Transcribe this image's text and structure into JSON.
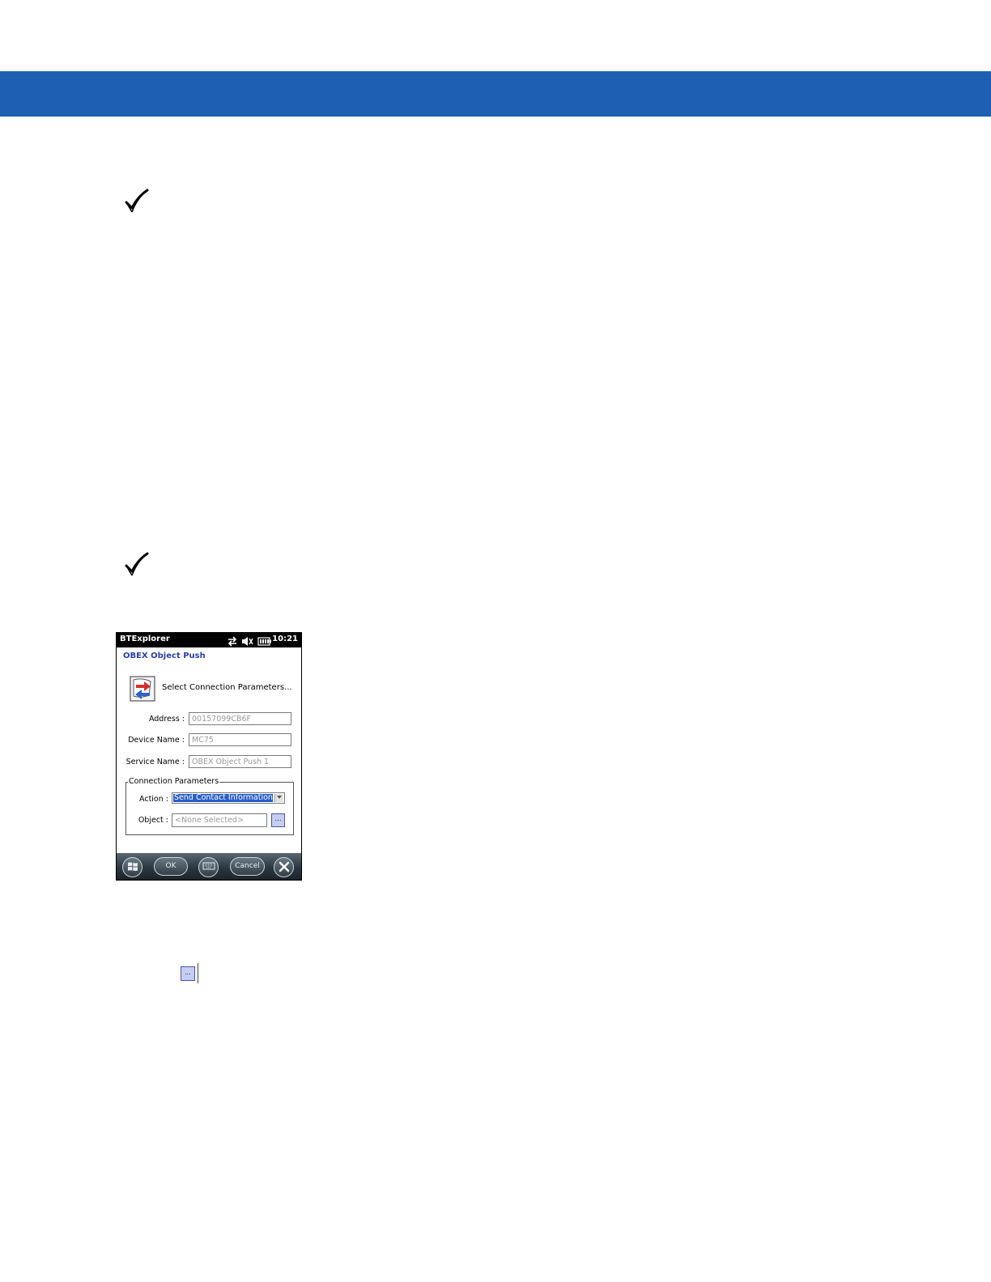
{
  "page": {
    "header_band_color": "#1e5fb4",
    "note_icon": "checkmark-icon"
  },
  "phone": {
    "status_bar": {
      "app_title": "BTExplorer",
      "icons": [
        "connectivity-icon",
        "speaker-muted-icon",
        "battery-icon"
      ],
      "time": "10:21"
    },
    "screen_title": "OBEX Object Push",
    "prompt": "Select Connection Parameters...",
    "fields": [
      {
        "label": "Address :",
        "value": "00157099CB6F"
      },
      {
        "label": "Device Name :",
        "value": "MC75"
      },
      {
        "label": "Service Name :",
        "value": "OBEX Object Push 1"
      }
    ],
    "connection_parameters": {
      "group_title": "Connection Parameters",
      "action_label": "Action :",
      "action_value": "Send Contact Information",
      "object_label": "Object :",
      "object_placeholder": "<None Selected>",
      "browse_label": "..."
    },
    "taskbar": {
      "start_icon": "windows-start-icon",
      "ok_label": "OK",
      "keyboard_icon": "keyboard-icon",
      "cancel_label": "Cancel",
      "close_icon": "close-icon"
    }
  },
  "inline_browse_label": "..."
}
